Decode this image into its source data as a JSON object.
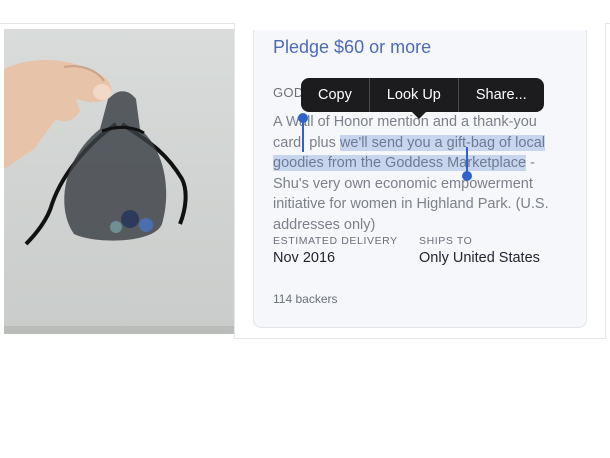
{
  "reward": {
    "title": "Pledge $60 or more",
    "heading_visible": "GOD",
    "description": {
      "before": "A Wall of Honor mention and a thank-you card, plus ",
      "selected": "we'll send you a gift-bag of local goodies from the Goddess Marketplace",
      "after": " - Shu's very own economic empowerment initiative for women in Highland Park. (U.S. addresses only)"
    },
    "estimated_delivery_label": "ESTIMATED DELIVERY",
    "estimated_delivery_value": "Nov 2016",
    "ships_to_label": "SHIPS TO",
    "ships_to_value": "Only United States",
    "backers": "114 backers"
  },
  "context_menu": {
    "copy": "Copy",
    "look_up": "Look Up",
    "share": "Share..."
  },
  "colors": {
    "accent": "#4d6bb3",
    "selection": "#c7d6ee",
    "handle": "#2f63c9",
    "menu_bg": "#1c1c1e"
  }
}
